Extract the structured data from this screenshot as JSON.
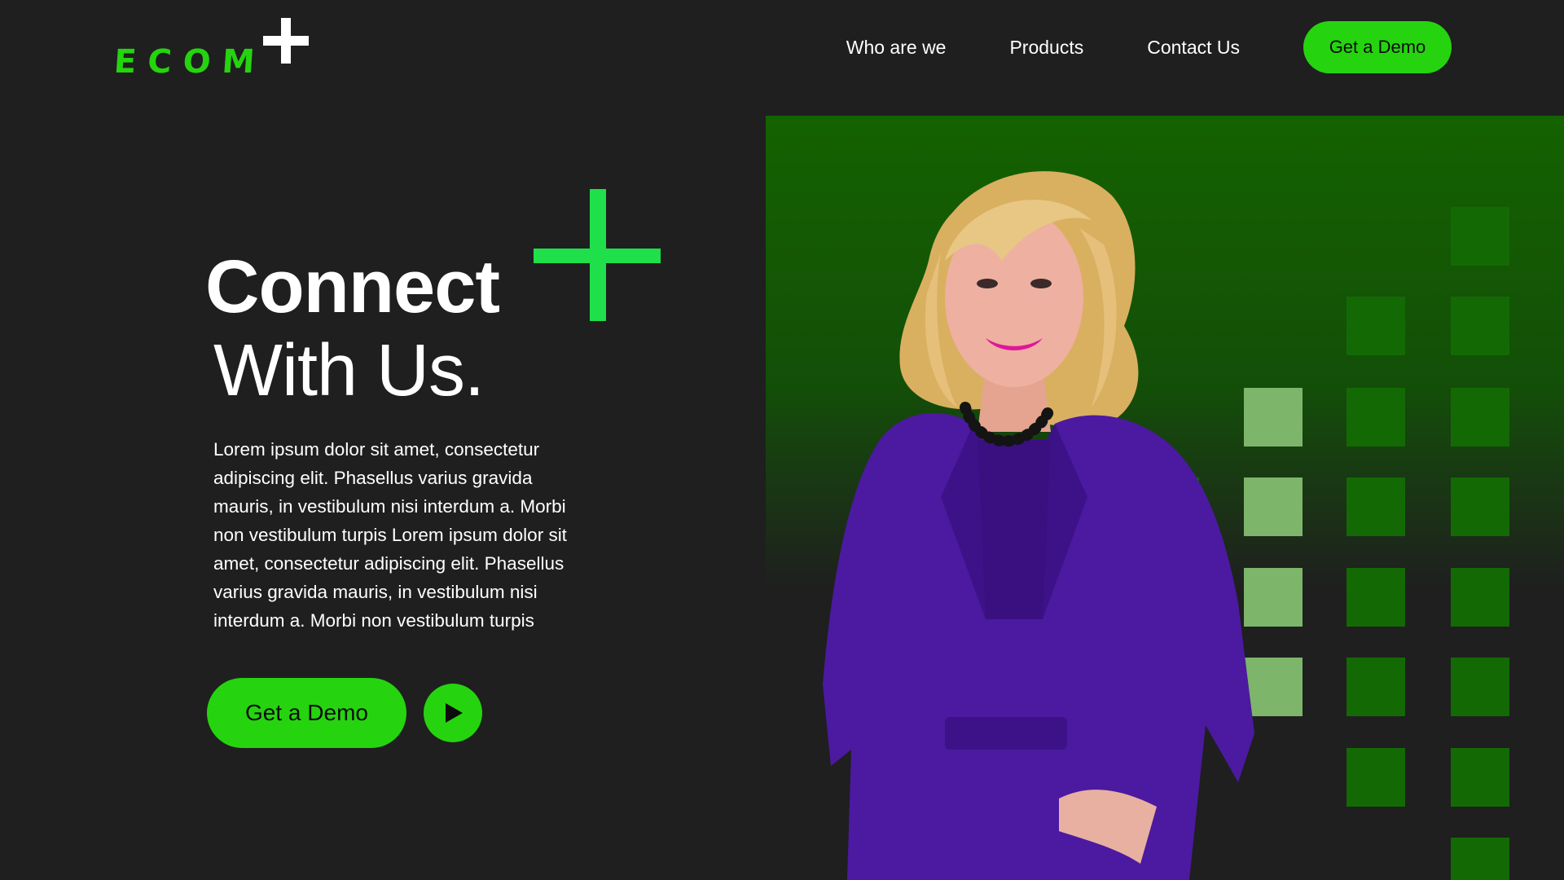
{
  "brand": {
    "logo_text": "ECOM",
    "logo_icon": "plus-icon",
    "accent_color": "#25d40f",
    "accent_bright": "#1fe04a",
    "panel_green": "#146200",
    "background": "#1f1f1f"
  },
  "nav": {
    "links": [
      {
        "label": "Who are we"
      },
      {
        "label": "Products"
      },
      {
        "label": "Contact Us"
      }
    ],
    "cta_label": "Get a Demo"
  },
  "hero": {
    "headline_line1": "Connect",
    "headline_line2": "With Us.",
    "body": "Lorem ipsum dolor sit amet, consectetur adipiscing elit. Phasellus varius gravida mauris, in vestibulum nisi interdum a. Morbi non vestibulum turpis Lorem ipsum dolor sit amet, consectetur adipiscing elit. Phasellus varius gravida mauris, in vestibulum nisi interdum a. Morbi non vestibulum turpis",
    "cta_label": "Get a Demo",
    "play_icon": "play-icon"
  },
  "visual": {
    "image_subject": "woman-in-purple-blazer-portrait",
    "jacket_color": "#4b1aa0",
    "hair_color": "#e4bf78"
  }
}
